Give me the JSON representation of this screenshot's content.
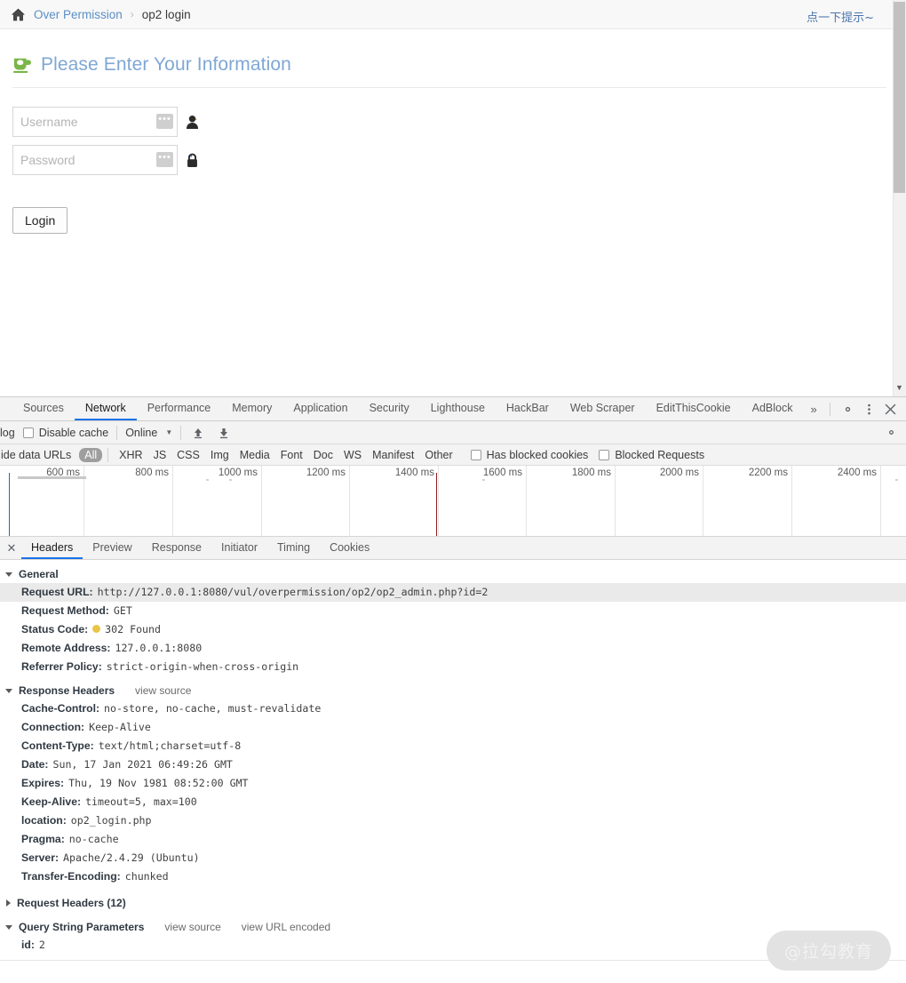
{
  "page": {
    "breadcrumb": {
      "home_icon": "home-icon",
      "root_label": "Over Permission",
      "separator": "›",
      "current_label": "op2 login"
    },
    "hint_link": "点一下提示~",
    "heading": {
      "icon": "coffee-cup-icon",
      "title": "Please Enter Your Information"
    },
    "form": {
      "username": {
        "placeholder": "Username",
        "value": "",
        "badge": "•••",
        "icon": "user-icon"
      },
      "password": {
        "placeholder": "Password",
        "value": "",
        "badge": "•••",
        "icon": "lock-icon"
      },
      "submit_label": "Login"
    }
  },
  "devtools": {
    "tabs": [
      {
        "label": "Sources",
        "active": false
      },
      {
        "label": "Network",
        "active": true
      },
      {
        "label": "Performance",
        "active": false
      },
      {
        "label": "Memory",
        "active": false
      },
      {
        "label": "Application",
        "active": false
      },
      {
        "label": "Security",
        "active": false
      },
      {
        "label": "Lighthouse",
        "active": false
      },
      {
        "label": "HackBar",
        "active": false
      },
      {
        "label": "Web Scraper",
        "active": false
      },
      {
        "label": "EditThisCookie",
        "active": false
      },
      {
        "label": "AdBlock",
        "active": false
      }
    ],
    "tabs_overflow": "»",
    "tabbar_icons": [
      "gear-icon",
      "kebab-menu-icon",
      "close-icon"
    ],
    "toolbar": {
      "preserve_log_label": "log",
      "disable_cache_label": "Disable cache",
      "disable_cache_checked": false,
      "throttling_value": "Online",
      "caret": "▼",
      "import_icon": "upload-arrow-icon",
      "export_icon": "download-arrow-icon",
      "settings_icon": "gear-icon"
    },
    "filterbar": {
      "hide_data_urls_label": "Hide data URLs",
      "types": [
        "All",
        "XHR",
        "JS",
        "CSS",
        "Img",
        "Media",
        "Font",
        "Doc",
        "WS",
        "Manifest",
        "Other"
      ],
      "selected_type": "All",
      "has_blocked_cookies_label": "Has blocked cookies",
      "has_blocked_cookies_checked": false,
      "blocked_requests_label": "Blocked Requests",
      "blocked_requests_checked": false
    },
    "overview": {
      "tick_labels": [
        "600 ms",
        "800 ms",
        "1000 ms",
        "1200 ms",
        "1400 ms",
        "1600 ms",
        "1800 ms",
        "2000 ms",
        "2200 ms",
        "2400 ms"
      ],
      "dom_content_loaded_color": "#2f60c4",
      "load_event_color": "#8e2020"
    },
    "detail_tabs": [
      {
        "label": "Headers",
        "active": true
      },
      {
        "label": "Preview",
        "active": false
      },
      {
        "label": "Response",
        "active": false
      },
      {
        "label": "Initiator",
        "active": false
      },
      {
        "label": "Timing",
        "active": false
      },
      {
        "label": "Cookies",
        "active": false
      }
    ],
    "sections": {
      "general": {
        "title": "General",
        "expanded": true,
        "rows": [
          {
            "key": "Request URL:",
            "value": "http://127.0.0.1:8080/vul/overpermission/op2/op2_admin.php?id=2"
          },
          {
            "key": "Request Method:",
            "value": "GET"
          },
          {
            "key": "Status Code:",
            "value": "302  Found",
            "status_dot": "#e8c547"
          },
          {
            "key": "Remote Address:",
            "value": "127.0.0.1:8080"
          },
          {
            "key": "Referrer Policy:",
            "value": "strict-origin-when-cross-origin"
          }
        ]
      },
      "response_headers": {
        "title": "Response Headers",
        "expanded": true,
        "view_source_label": "view source",
        "rows": [
          {
            "key": "Cache-Control:",
            "value": "no-store, no-cache, must-revalidate"
          },
          {
            "key": "Connection:",
            "value": "Keep-Alive"
          },
          {
            "key": "Content-Type:",
            "value": "text/html;charset=utf-8"
          },
          {
            "key": "Date:",
            "value": "Sun, 17 Jan 2021 06:49:26 GMT"
          },
          {
            "key": "Expires:",
            "value": "Thu, 19 Nov 1981 08:52:00 GMT"
          },
          {
            "key": "Keep-Alive:",
            "value": "timeout=5, max=100"
          },
          {
            "key": "location:",
            "value": "op2_login.php"
          },
          {
            "key": "Pragma:",
            "value": "no-cache"
          },
          {
            "key": "Server:",
            "value": "Apache/2.4.29 (Ubuntu)"
          },
          {
            "key": "Transfer-Encoding:",
            "value": "chunked"
          }
        ]
      },
      "request_headers": {
        "title": "Request Headers (12)",
        "expanded": false
      },
      "query_string_parameters": {
        "title": "Query String Parameters",
        "expanded": true,
        "view_source_label": "view source",
        "view_url_encoded_label": "view URL encoded",
        "rows": [
          {
            "key": "id:",
            "value": "2"
          }
        ]
      }
    }
  },
  "watermark": "@拉勾教育"
}
